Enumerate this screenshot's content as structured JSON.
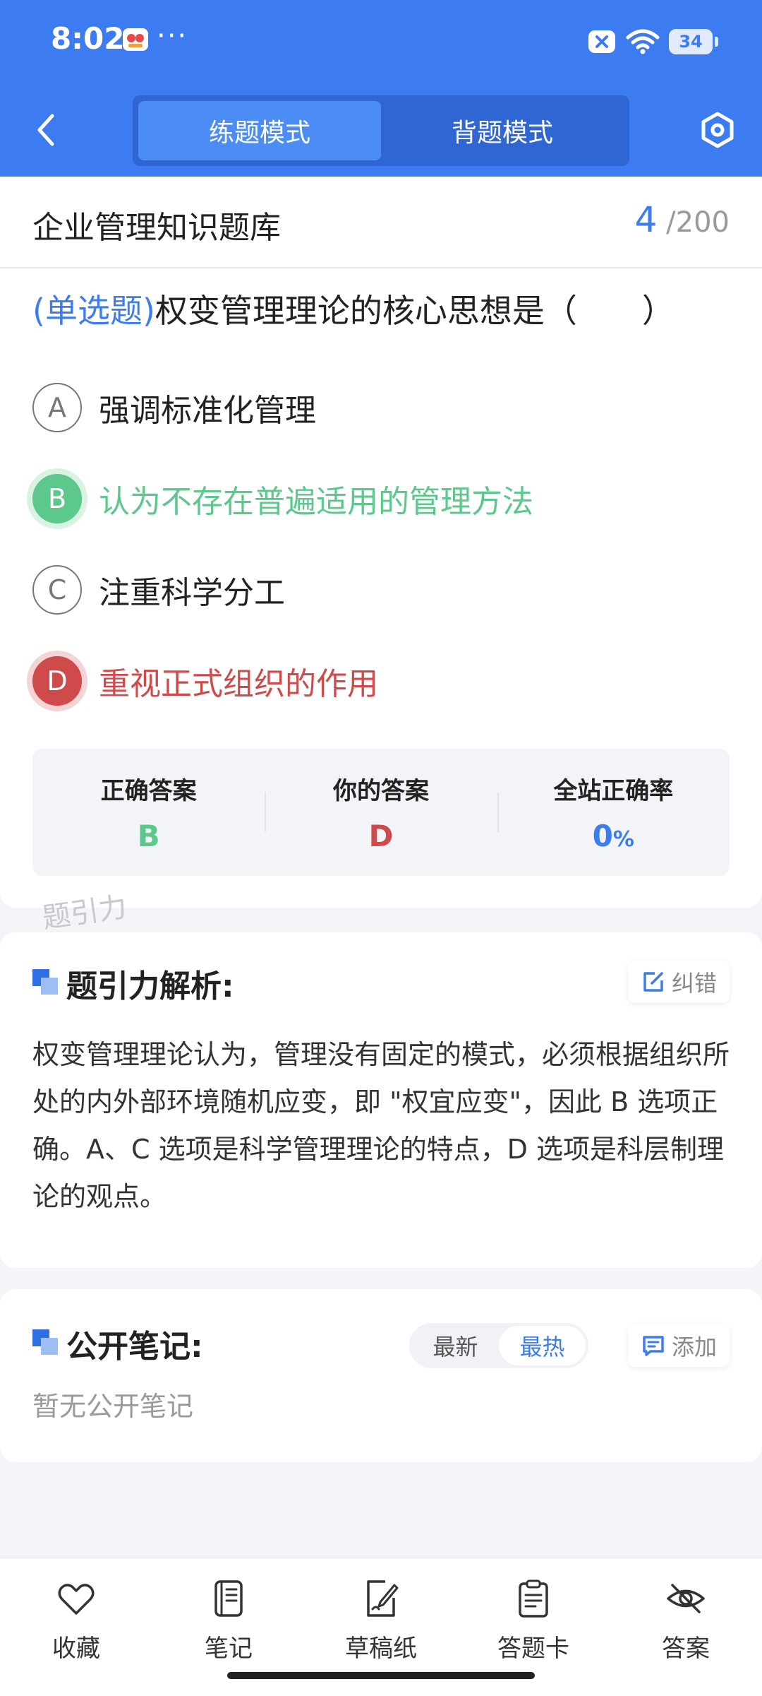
{
  "status_bar": {
    "time": "8:02",
    "dots": "···",
    "battery": "34"
  },
  "header": {
    "mode_tabs": [
      {
        "label": "练题模式",
        "active": true
      },
      {
        "label": "背题模式",
        "active": false
      }
    ]
  },
  "question_card": {
    "bank_title": "企业管理知识题库",
    "progress_current": "4",
    "progress_total": "/200",
    "question_type": "(单选题)",
    "question_text": "权变管理理论的核心思想是（　　）",
    "options": [
      {
        "letter": "A",
        "text": "强调标准化管理",
        "state": "normal"
      },
      {
        "letter": "B",
        "text": "认为不存在普遍适用的管理方法",
        "state": "correct"
      },
      {
        "letter": "C",
        "text": "注重科学分工",
        "state": "normal"
      },
      {
        "letter": "D",
        "text": "重视正式组织的作用",
        "state": "wrong"
      }
    ],
    "answer_summary": {
      "correct_label": "正确答案",
      "correct_value": "B",
      "yours_label": "你的答案",
      "yours_value": "D",
      "rate_label": "全站正确率",
      "rate_value": "0",
      "rate_unit": "%"
    }
  },
  "watermark": "题引力",
  "analysis": {
    "title": "题引力解析:",
    "report_button": "纠错",
    "text": "权变管理理论认为，管理没有固定的模式，必须根据组织所处的内外部环境随机应变，即 \"权宜应变\"，因此 B 选项正确。A、C 选项是科学管理理论的特点，D 选项是科层制理论的观点。"
  },
  "notes": {
    "title": "公开笔记:",
    "sort_options": [
      {
        "label": "最新",
        "active": false
      },
      {
        "label": "最热",
        "active": true
      }
    ],
    "add_button": "添加",
    "empty_text": "暂无公开笔记"
  },
  "bottom_bar": {
    "items": [
      {
        "label": "收藏",
        "icon": "heart-icon"
      },
      {
        "label": "笔记",
        "icon": "notebook-icon"
      },
      {
        "label": "草稿纸",
        "icon": "draft-icon"
      },
      {
        "label": "答题卡",
        "icon": "clipboard-icon"
      },
      {
        "label": "答案",
        "icon": "eye-off-icon"
      }
    ]
  },
  "colors": {
    "primary": "#3d7cf0",
    "correct": "#5cc88b",
    "wrong": "#cf4b4b"
  }
}
